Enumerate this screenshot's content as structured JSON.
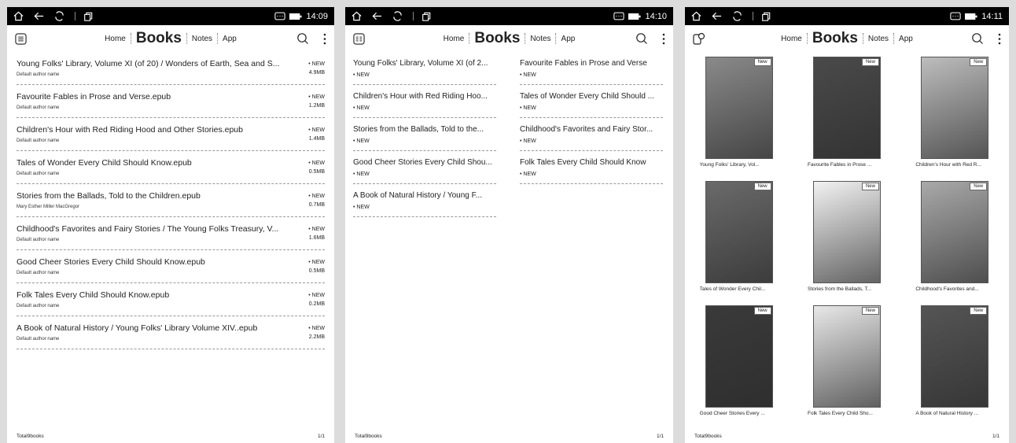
{
  "panels": [
    {
      "time": "14:09",
      "nav": [
        "Home",
        "Books",
        "Notes",
        "App"
      ],
      "footer_total": "Total9books",
      "footer_page": "1/1"
    },
    {
      "time": "14:10",
      "nav": [
        "Home",
        "Books",
        "Notes",
        "App"
      ],
      "footer_total": "Total9books",
      "footer_page": "1/1"
    },
    {
      "time": "14:11",
      "nav": [
        "Home",
        "Books",
        "Notes",
        "App"
      ],
      "footer_total": "Total9books",
      "footer_page": "1/1"
    }
  ],
  "list_view": [
    {
      "title": "Young Folks' Library, Volume XI (of 20) / Wonders of Earth, Sea and S...",
      "author": "Default author name",
      "badge": "• NEW",
      "size": "4.9MB"
    },
    {
      "title": "Favourite Fables in Prose and Verse.epub",
      "author": "Default author name",
      "badge": "• NEW",
      "size": "1.2MB"
    },
    {
      "title": "Children's Hour with Red Riding Hood and Other Stories.epub",
      "author": "Default author name",
      "badge": "• NEW",
      "size": "1.4MB"
    },
    {
      "title": "Tales of Wonder Every Child Should Know.epub",
      "author": "Default author name",
      "badge": "• NEW",
      "size": "0.5MB"
    },
    {
      "title": "Stories from the Ballads, Told to the Children.epub",
      "author": "Mary Esther Miller MacGregor",
      "badge": "• NEW",
      "size": "0.7MB"
    },
    {
      "title": "Childhood's Favorites and Fairy Stories / The Young Folks Treasury, V...",
      "author": "Default author name",
      "badge": "• NEW",
      "size": "1.6MB"
    },
    {
      "title": "Good Cheer Stories Every Child Should Know.epub",
      "author": "Default author name",
      "badge": "• NEW",
      "size": "0.5MB"
    },
    {
      "title": "Folk Tales Every Child Should Know.epub",
      "author": "Default author name",
      "badge": "• NEW",
      "size": "0.2MB"
    },
    {
      "title": "A Book of Natural History / Young Folks' Library Volume XIV..epub",
      "author": "Default author name",
      "badge": "• NEW",
      "size": "2.2MB"
    }
  ],
  "two_col_view": {
    "left": [
      {
        "title": "Young Folks' Library, Volume XI (of 2...",
        "badge": "• NEW"
      },
      {
        "title": "Children's Hour with Red Riding Hoo...",
        "badge": "• NEW"
      },
      {
        "title": "Stories from the Ballads, Told to the...",
        "badge": "• NEW"
      },
      {
        "title": "Good Cheer Stories Every Child Shou...",
        "badge": "• NEW"
      },
      {
        "title": "A Book of Natural History / Young F...",
        "badge": "• NEW"
      }
    ],
    "right": [
      {
        "title": "Favourite Fables in Prose and Verse",
        "badge": "• NEW"
      },
      {
        "title": "Tales of Wonder Every Child Should ...",
        "badge": "• NEW"
      },
      {
        "title": "Childhood's Favorites and Fairy Stor...",
        "badge": "• NEW"
      },
      {
        "title": "Folk Tales Every Child Should Know",
        "badge": "• NEW"
      }
    ]
  },
  "cover_view": [
    {
      "title": "Young Folks' Library, Vol...",
      "badge": "New",
      "tone": "#8a8a8a"
    },
    {
      "title": "Favourite Fables in Prose ...",
      "badge": "New",
      "tone": "#4a4a4a"
    },
    {
      "title": "Children's Hour with Red R...",
      "badge": "New",
      "tone": "#bdbdbd"
    },
    {
      "title": "Tales of Wonder Every Chil...",
      "badge": "New",
      "tone": "#6a6a6a"
    },
    {
      "title": "Stories from the Ballads, T...",
      "badge": "New",
      "tone": "#f2f2f2"
    },
    {
      "title": "Childhood's Favorites and...",
      "badge": "New",
      "tone": "#a9a9a9"
    },
    {
      "title": "Good Cheer Stories Every ...",
      "badge": "New",
      "tone": "#3a3a3a"
    },
    {
      "title": "Folk Tales Every Child Sho...",
      "badge": "New",
      "tone": "#e8e8e8"
    },
    {
      "title": "A Book of Natural History ...",
      "badge": "New",
      "tone": "#555555"
    }
  ]
}
